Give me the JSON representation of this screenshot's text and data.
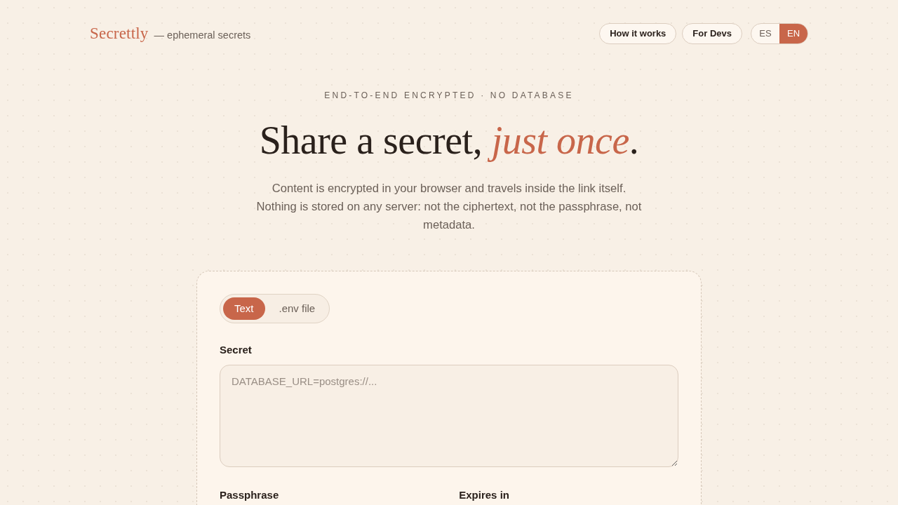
{
  "header": {
    "logo": "Secrettly",
    "tagline": "— ephemeral secrets",
    "nav": [
      {
        "label": "How it works"
      },
      {
        "label": "For Devs"
      }
    ],
    "languages": [
      {
        "label": "ES",
        "selected": false
      },
      {
        "label": "EN",
        "selected": true
      }
    ]
  },
  "hero": {
    "eyebrow": "END-TO-END ENCRYPTED · NO DATABASE",
    "title": "Share a secret, *just once*.",
    "description": "Content is encrypted in your browser and travels inside the link itself. Nothing is stored on any server: not the ciphertext, not the passphrase, not metadata."
  },
  "form": {
    "modes": [
      {
        "label": "Text",
        "selected": true
      },
      {
        "label": ".env file",
        "selected": false
      }
    ],
    "secret": {
      "label": "Secret",
      "placeholder": "DATABASE_URL=postgres://..."
    },
    "fields": [
      {
        "label": "Passphrase"
      },
      {
        "label": "Expires in"
      }
    ]
  }
}
